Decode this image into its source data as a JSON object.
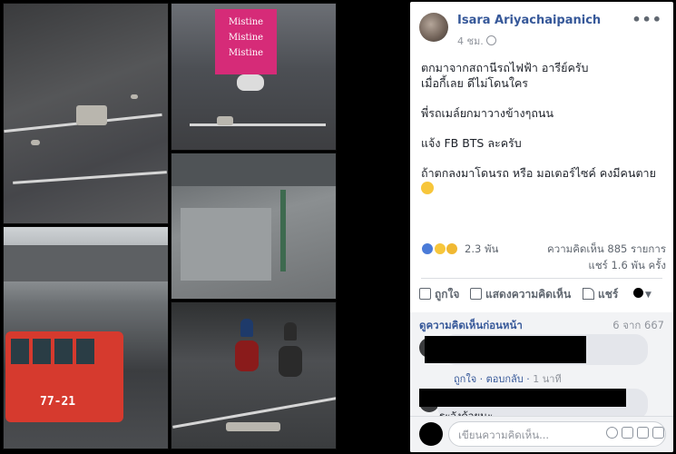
{
  "post": {
    "author": "Isara Ariyachaipanich",
    "time": "4 ชม.",
    "lines": [
      "ตกมาจากสถานีรถไฟฟ้า อารีย์ครับ",
      "เมื่อกี้เลย ดีไม่โดนใคร",
      "พี่รถเมล์ยกมาวางข้างๆถนน",
      "แจ้ง FB BTS ละครับ",
      "ถ้าตกลงมาโดนรถ หรือ มอเตอร์ไซค์ คงมีคนตาย"
    ]
  },
  "stats": {
    "reactions": "2.3 พัน",
    "comments": "ความคิดเห็น 885 รายการ",
    "shares": "แชร์ 1.6 พัน ครั้ง"
  },
  "actions": {
    "like": "ถูกใจ",
    "comment": "แสดงความคิดเห็น",
    "share": "แชร์"
  },
  "comments": {
    "prev_label": "ดูความคิดเห็นก่อนหน้า",
    "pager": "6 จาก 667",
    "c1_like": "ถูกใจ",
    "c1_reply": "ตอบกลับ",
    "c1_time": "1 นาที",
    "c2_text": "ระวังด้วยนะ",
    "composer_placeholder": "เขียนความคิดเห็น..."
  },
  "photos": {
    "billboard": [
      "Mistine",
      "Mistine",
      "Mistine"
    ],
    "bus_number": "77-21"
  }
}
